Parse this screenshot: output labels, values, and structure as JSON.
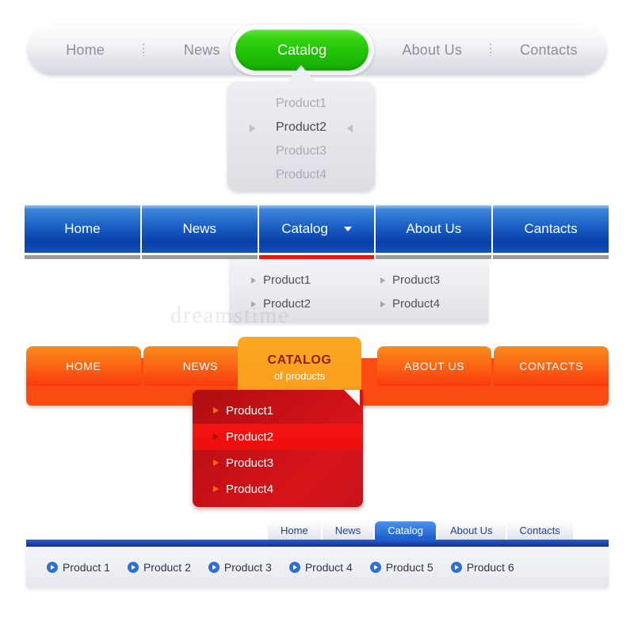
{
  "colors": {
    "green_accent": "#21c406",
    "blue_accent": "#1a5fc4",
    "orange_accent": "#fb6a16",
    "red_accent": "#c41016",
    "red_underline": "#e01b15",
    "gray_underline": "#9a9a9a",
    "tab_blue": "#2f76dd"
  },
  "menu_gray_pill": {
    "items": [
      {
        "label": "Home",
        "state": "normal"
      },
      {
        "label": "News",
        "state": "normal"
      },
      {
        "label": "Catalog",
        "state": "active"
      },
      {
        "label": "About Us",
        "state": "normal"
      },
      {
        "label": "Contacts",
        "state": "normal"
      }
    ],
    "dropdown": {
      "items": [
        {
          "label": "Product1",
          "selected": false
        },
        {
          "label": "Product2",
          "selected": true
        },
        {
          "label": "Product3",
          "selected": false
        },
        {
          "label": "Product4",
          "selected": false
        }
      ]
    }
  },
  "menu_blue_bar": {
    "items": [
      {
        "label": "Home",
        "active": false
      },
      {
        "label": "News",
        "active": false
      },
      {
        "label": "Catalog",
        "active": true
      },
      {
        "label": "About Us",
        "active": false
      },
      {
        "label": "Cantacts",
        "active": false
      }
    ],
    "dropdown": {
      "items": [
        "Product1",
        "Product3",
        "Product2",
        "Product4"
      ]
    }
  },
  "menu_orange": {
    "items": [
      {
        "label": "HOME"
      },
      {
        "label": "NEWS"
      },
      {
        "label": "ABOUT US"
      },
      {
        "label": "CONTACTS"
      }
    ],
    "catalog_tab": {
      "title": "CATALOG",
      "subtitle": "of products"
    },
    "dropdown": {
      "items": [
        {
          "label": "Product1",
          "highlighted": false
        },
        {
          "label": "Product2",
          "highlighted": true
        },
        {
          "label": "Product3",
          "highlighted": false
        },
        {
          "label": "Product4",
          "highlighted": false
        }
      ]
    }
  },
  "menu_bottom_tabs": {
    "tabs": [
      {
        "label": "Home",
        "active": false
      },
      {
        "label": "News",
        "active": false
      },
      {
        "label": "Catalog",
        "active": true
      },
      {
        "label": "About Us",
        "active": false
      },
      {
        "label": "Contacts",
        "active": false
      }
    ],
    "products": [
      "Product 1",
      "Product 2",
      "Product 3",
      "Product 4",
      "Product 5",
      "Product 6"
    ]
  },
  "watermark": {
    "text": "dreamstime"
  }
}
